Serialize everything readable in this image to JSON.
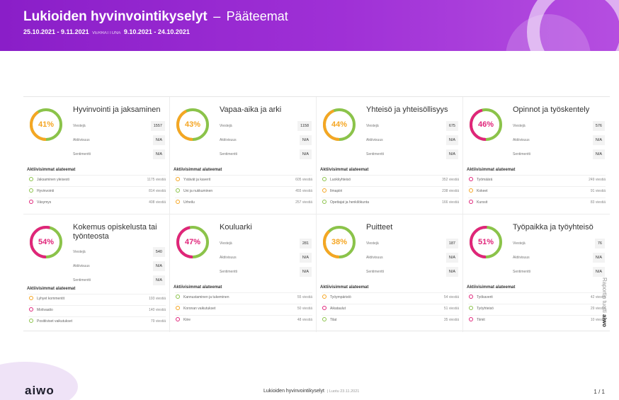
{
  "header": {
    "title": "Lukioiden hyvinvointikyselyt",
    "separator": "–",
    "subtitle": "Pääteemat",
    "date_range": "25.10.2021 - 9.11.2021",
    "compare_label": "VERRATTUNA",
    "compare_range": "9.10.2021 - 24.10.2021"
  },
  "labels": {
    "posts": "Viestejä",
    "activity": "Aktiivisuus",
    "sentiment": "Sentimentti",
    "top_subtopics": "Aktiivisimmat alateemat"
  },
  "colors": {
    "header": "#9226cc",
    "green": "#8bc34a",
    "orange": "#f5a623",
    "pink": "#e0257a"
  },
  "themes": [
    {
      "title": "Hyvinvointi ja jaksaminen",
      "percent": "41%",
      "percent_value": 41,
      "posts": "1557",
      "activity": "N/A",
      "sentiment": "N/A",
      "subtopics": [
        {
          "name": "Jaksaminen yleisesti",
          "count": "1175 viestiä",
          "color": "green"
        },
        {
          "name": "Hyvinvointi",
          "count": "814 viestiä",
          "color": "green"
        },
        {
          "name": "Väsymys",
          "count": "408 viestiä",
          "color": "pink"
        }
      ]
    },
    {
      "title": "Vapaa-aika ja arki",
      "percent": "43%",
      "percent_value": 43,
      "posts": "1158",
      "activity": "N/A",
      "sentiment": "N/A",
      "subtopics": [
        {
          "name": "Ystävät ja kaverit",
          "count": "605 viestiä",
          "color": "orange"
        },
        {
          "name": "Uni ja nukkuminen",
          "count": "455 viestiä",
          "color": "green"
        },
        {
          "name": "Urheilu",
          "count": "257 viestiä",
          "color": "orange"
        }
      ]
    },
    {
      "title": "Yhteisö ja yhteisöllisyys",
      "percent": "44%",
      "percent_value": 44,
      "posts": "675",
      "activity": "N/A",
      "sentiment": "N/A",
      "subtopics": [
        {
          "name": "Luokkyhteisö",
          "count": "352 viestiä",
          "color": "green"
        },
        {
          "name": "Ilmapiiri",
          "count": "238 viestiä",
          "color": "orange"
        },
        {
          "name": "Opettajat ja henkilökunta",
          "count": "166 viestiä",
          "color": "green"
        }
      ]
    },
    {
      "title": "Opinnot ja työskentely",
      "percent": "46%",
      "percent_value": 46,
      "posts": "576",
      "activity": "N/A",
      "sentiment": "N/A",
      "subtopics": [
        {
          "name": "Työmäärä",
          "count": "249 viestiä",
          "color": "pink"
        },
        {
          "name": "Kokeet",
          "count": "91 viestiä",
          "color": "orange"
        },
        {
          "name": "Kurssit",
          "count": "83 viestiä",
          "color": "pink"
        }
      ]
    },
    {
      "title": "Kokemus opiskelusta tai työnteosta",
      "percent": "54%",
      "percent_value": 54,
      "posts": "540",
      "activity": "N/A",
      "sentiment": "N/A",
      "subtopics": [
        {
          "name": "Lyhyet kommentit",
          "count": "193 viestiä",
          "color": "orange"
        },
        {
          "name": "Motivaatio",
          "count": "140 viestiä",
          "color": "pink"
        },
        {
          "name": "Positiiviset vaikutukset",
          "count": "79 viestiä",
          "color": "green"
        }
      ]
    },
    {
      "title": "Kouluarki",
      "percent": "47%",
      "percent_value": 47,
      "posts": "281",
      "activity": "N/A",
      "sentiment": "N/A",
      "subtopics": [
        {
          "name": "Kannustaminen ja tukeminen",
          "count": "55 viestiä",
          "color": "green"
        },
        {
          "name": "Koronan vaikutukset",
          "count": "50 viestiä",
          "color": "orange"
        },
        {
          "name": "Kiire",
          "count": "48 viestiä",
          "color": "pink"
        }
      ]
    },
    {
      "title": "Puitteet",
      "percent": "38%",
      "percent_value": 38,
      "posts": "187",
      "activity": "N/A",
      "sentiment": "N/A",
      "subtopics": [
        {
          "name": "Työympäristö",
          "count": "54 viestiä",
          "color": "orange"
        },
        {
          "name": "Aikataulut",
          "count": "51 viestiä",
          "color": "pink"
        },
        {
          "name": "Tilat",
          "count": "35 viestiä",
          "color": "green"
        }
      ]
    },
    {
      "title": "Työpaikka ja työyhteisö",
      "percent": "51%",
      "percent_value": 51,
      "posts": "76",
      "activity": "N/A",
      "sentiment": "N/A",
      "subtopics": [
        {
          "name": "Työkaverit",
          "count": "42 viestiä",
          "color": "pink"
        },
        {
          "name": "Työyhteisö",
          "count": "29 viestiä",
          "color": "green"
        },
        {
          "name": "Tiimit",
          "count": "10 viestiä",
          "color": "pink"
        }
      ]
    }
  ],
  "side": {
    "text": "Raportin tuotti",
    "logo": "aiwo"
  },
  "footer": {
    "logo": "aiwo",
    "report_title": "Lukioiden hyvinvointikyselyt",
    "report_meta": "| Luotu 23.11.2021",
    "page": "1 / 1"
  }
}
